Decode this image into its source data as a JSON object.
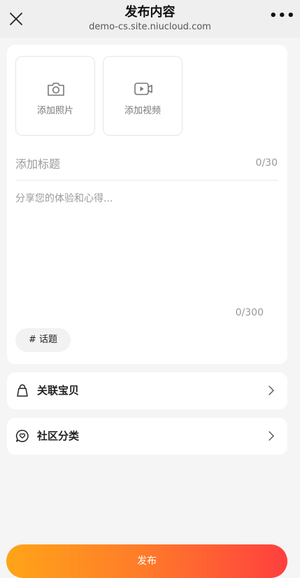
{
  "header": {
    "title": "发布内容",
    "subtitle": "demo-cs.site.niucloud.com",
    "more_label": "•••",
    "close_icon": "close-icon"
  },
  "upload": {
    "photo_label": "添加照片",
    "video_label": "添加视频",
    "photo_icon": "camera-icon",
    "video_icon": "video-camera-icon"
  },
  "post": {
    "title_placeholder": "添加标题",
    "title_count": "0/30",
    "content_placeholder": "分享您的体验和心得...",
    "content_count": "0/300",
    "topic_label": "# 话题"
  },
  "rows": {
    "products_label": "关联宝贝",
    "products_icon": "shopping-bag-icon",
    "category_label": "社区分类",
    "category_icon": "chat-heart-icon"
  },
  "actions": {
    "publish_label": "发布"
  },
  "colors": {
    "accent_start": "#ffa418",
    "accent_end": "#ff3f3f",
    "background": "#f5f5f5"
  }
}
